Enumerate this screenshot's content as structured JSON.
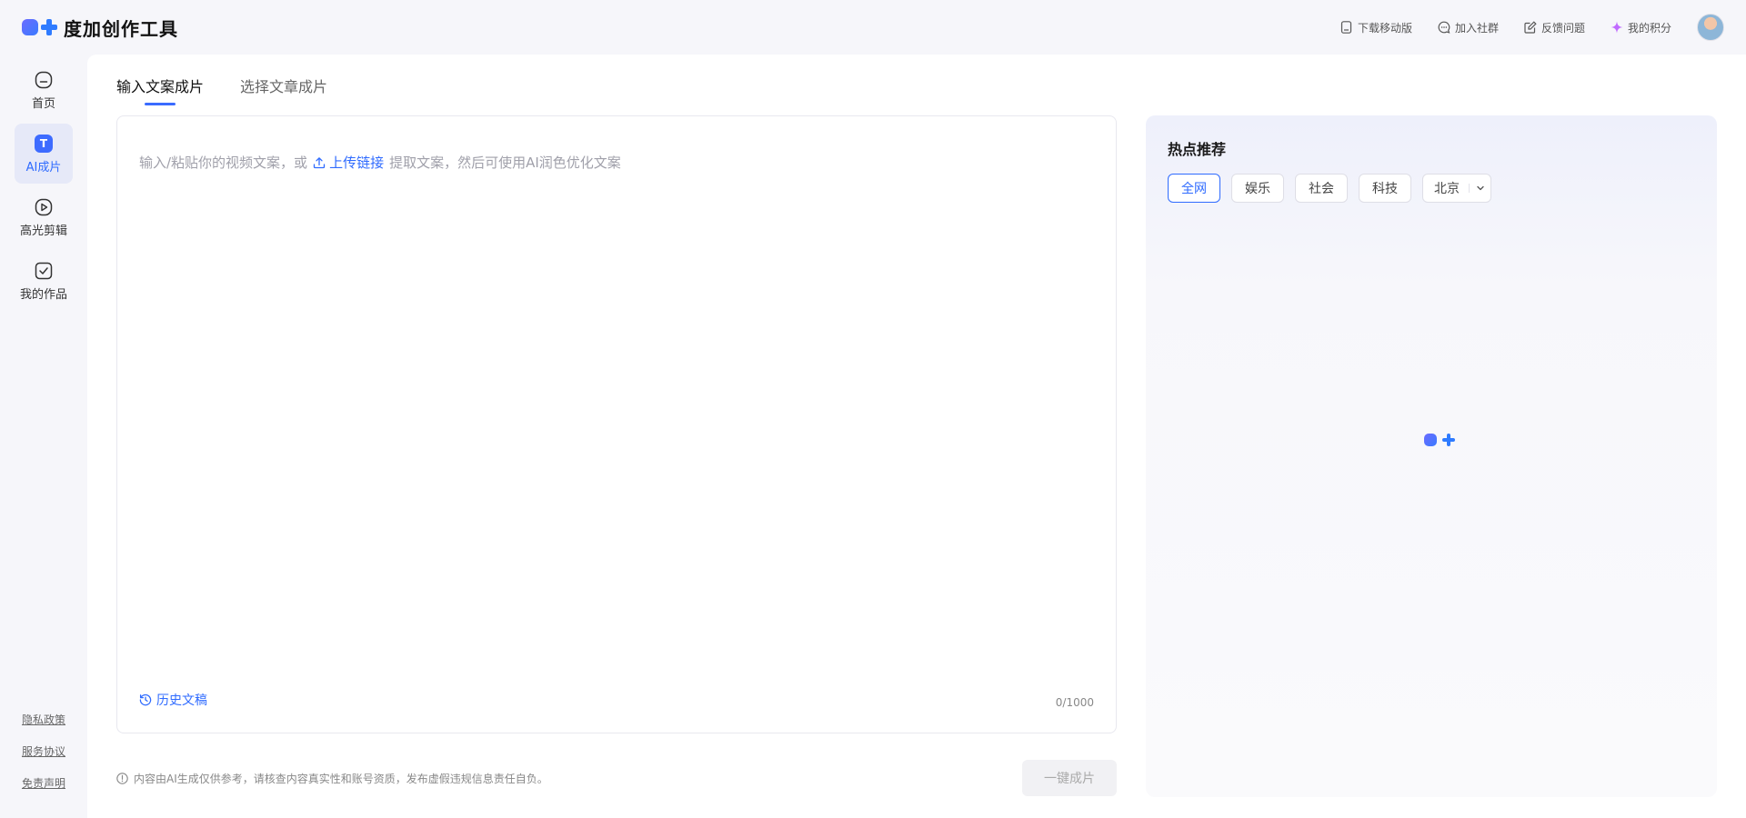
{
  "app": {
    "name": "度加创作工具"
  },
  "header": {
    "actions": [
      {
        "label": "下载移动版",
        "icon": "mobile-icon"
      },
      {
        "label": "加入社群",
        "icon": "chat-icon"
      },
      {
        "label": "反馈问题",
        "icon": "feedback-icon"
      },
      {
        "label": "我的积分",
        "icon": "sparkle-icon"
      }
    ]
  },
  "sidebar": {
    "items": [
      {
        "label": "首页",
        "icon": "home-icon"
      },
      {
        "label": "AI成片",
        "icon": "text-icon",
        "glyph": "T"
      },
      {
        "label": "高光剪辑",
        "icon": "play-icon"
      },
      {
        "label": "我的作品",
        "icon": "check-square-icon"
      }
    ],
    "footer": [
      "隐私政策",
      "服务协议",
      "免责声明"
    ]
  },
  "main": {
    "tabs": [
      {
        "label": "输入文案成片"
      },
      {
        "label": "选择文章成片"
      }
    ],
    "editor": {
      "placeholder_prefix": "输入/粘贴你的视频文案，或",
      "upload_label": "上传链接",
      "placeholder_suffix": "提取文案，然后可使用AI润色优化文案",
      "history_label": "历史文稿",
      "count": "0/1000"
    },
    "disclaimer": "内容由AI生成仅供参考，请核查内容真实性和账号资质，发布虚假违规信息责任自负。",
    "generate_label": "一键成片"
  },
  "hot": {
    "title": "热点推荐",
    "chips": [
      "全网",
      "娱乐",
      "社会",
      "科技"
    ],
    "region": "北京"
  },
  "colors": {
    "accent": "#2f6bff"
  }
}
